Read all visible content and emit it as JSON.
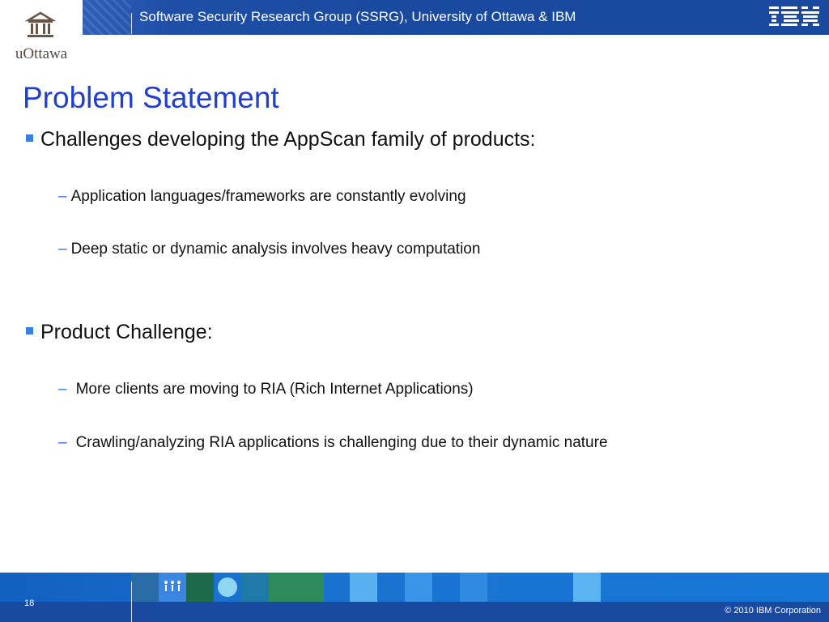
{
  "header": {
    "logo_text": "uOttawa",
    "title": "Software Security Research Group (SSRG), University of Ottawa & IBM"
  },
  "slide": {
    "title": "Problem Statement",
    "bullets": [
      {
        "text": "Challenges developing the AppScan family of products:",
        "subs": [
          "Application languages/frameworks are constantly evolving",
          "Deep static or dynamic analysis involves heavy computation"
        ]
      },
      {
        "text": "Product Challenge:",
        "subs": [
          "More clients are moving to RIA (Rich Internet Applications)",
          "Crawling/analyzing RIA applications is challenging due to their dynamic nature"
        ]
      }
    ],
    "dash": "–"
  },
  "footer": {
    "page_number": "18",
    "copyright": "© 2010 IBM Corporation"
  },
  "colors": {
    "title": "#1f3fd0",
    "banner": "#1a4aa0",
    "bullet": "#3a7fe0"
  }
}
